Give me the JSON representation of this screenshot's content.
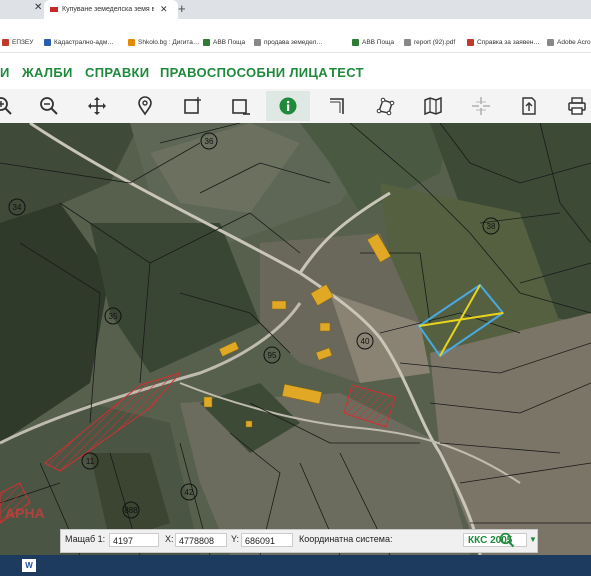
{
  "browser": {
    "tabs": [
      {
        "label": "Купуване земеделска земя в ш…",
        "active": true
      },
      {
        "label": "",
        "active": false
      }
    ],
    "new_tab_icon": "plus-icon",
    "address_hint": "",
    "bookmarks": [
      {
        "label": "ЕПЗЕУ",
        "color": "#c0392b"
      },
      {
        "label": "Кадастрално-адм…",
        "color": "#2b5fad"
      },
      {
        "label": "Shkolo.bg : Дигита…",
        "color": "#e08a00"
      },
      {
        "label": "ABB Поща",
        "color": "#2e7d32"
      },
      {
        "label": "продава земедел…",
        "color": "#888888"
      },
      {
        "label": "ABB Поща",
        "color": "#2e7d32"
      },
      {
        "label": "report (92).pdf",
        "color": "#888888"
      },
      {
        "label": "Справка за заявен…",
        "color": "#c0392b"
      },
      {
        "label": "Adobe Acro",
        "color": "#888888"
      }
    ]
  },
  "menu": {
    "items": [
      "И",
      "ЖАЛБИ",
      "СПРАВКИ",
      "ПРАВОСПОСОБНИ ЛИЦА",
      "ТЕСТ"
    ]
  },
  "toolbar": {
    "tools": [
      "zoom-in-icon",
      "zoom-out-icon",
      "pan-icon",
      "location-pin-icon",
      "select-rectangle-icon",
      "clear-selection-icon",
      "info-icon",
      "measure-icon",
      "polygon-icon",
      "map-icon",
      "crosshair-icon",
      "export-icon",
      "print-icon"
    ],
    "active_tool": "info-icon",
    "accent_color": "#1f8a3b"
  },
  "map": {
    "parcel_labels": [
      "36",
      "34",
      "38",
      "35",
      "95",
      "40",
      "11",
      "42",
      "888"
    ],
    "watermark": "АРНА"
  },
  "status": {
    "scale_label": "Мащаб 1:",
    "scale_value": "4197",
    "x_label": "X:",
    "x_value": "4778808",
    "y_label": "Y:",
    "y_value": "686091",
    "crs_label": "Координатна система:",
    "crs_value": "ККС 2005"
  },
  "taskbar": {
    "app": "W"
  }
}
